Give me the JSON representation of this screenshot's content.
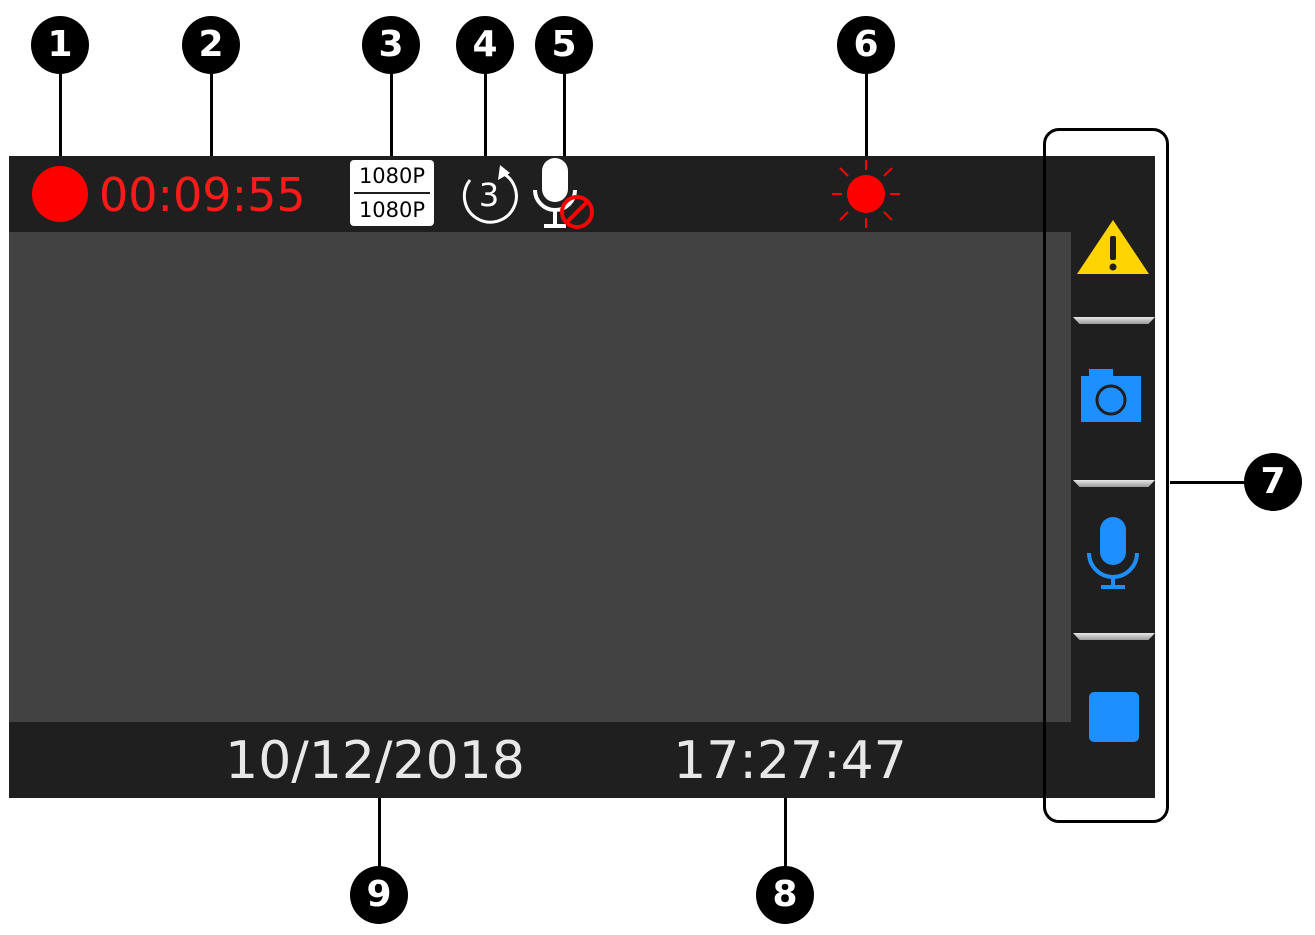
{
  "status_bar": {
    "recording_time": "00:09:55",
    "resolution_front": "1080P",
    "resolution_rear": "1080P",
    "loop_minutes": "3",
    "mic_state": "muted",
    "light_state": "on"
  },
  "footer": {
    "date": "10/12/2018",
    "time": "17:27:47"
  },
  "sidebar": {
    "buttons": [
      {
        "name": "emergency-lock",
        "icon": "warning-triangle-icon"
      },
      {
        "name": "snapshot",
        "icon": "camera-icon"
      },
      {
        "name": "microphone",
        "icon": "microphone-icon"
      },
      {
        "name": "stop",
        "icon": "stop-square-icon"
      }
    ]
  },
  "callouts": [
    "1",
    "2",
    "3",
    "4",
    "5",
    "6",
    "7",
    "8",
    "9"
  ],
  "colors": {
    "recording": "#ff0000",
    "warning": "#ffd400",
    "accent_blue": "#1e8fff",
    "screen_bg": "#1f1f1f",
    "viewport_bg": "#424242"
  }
}
